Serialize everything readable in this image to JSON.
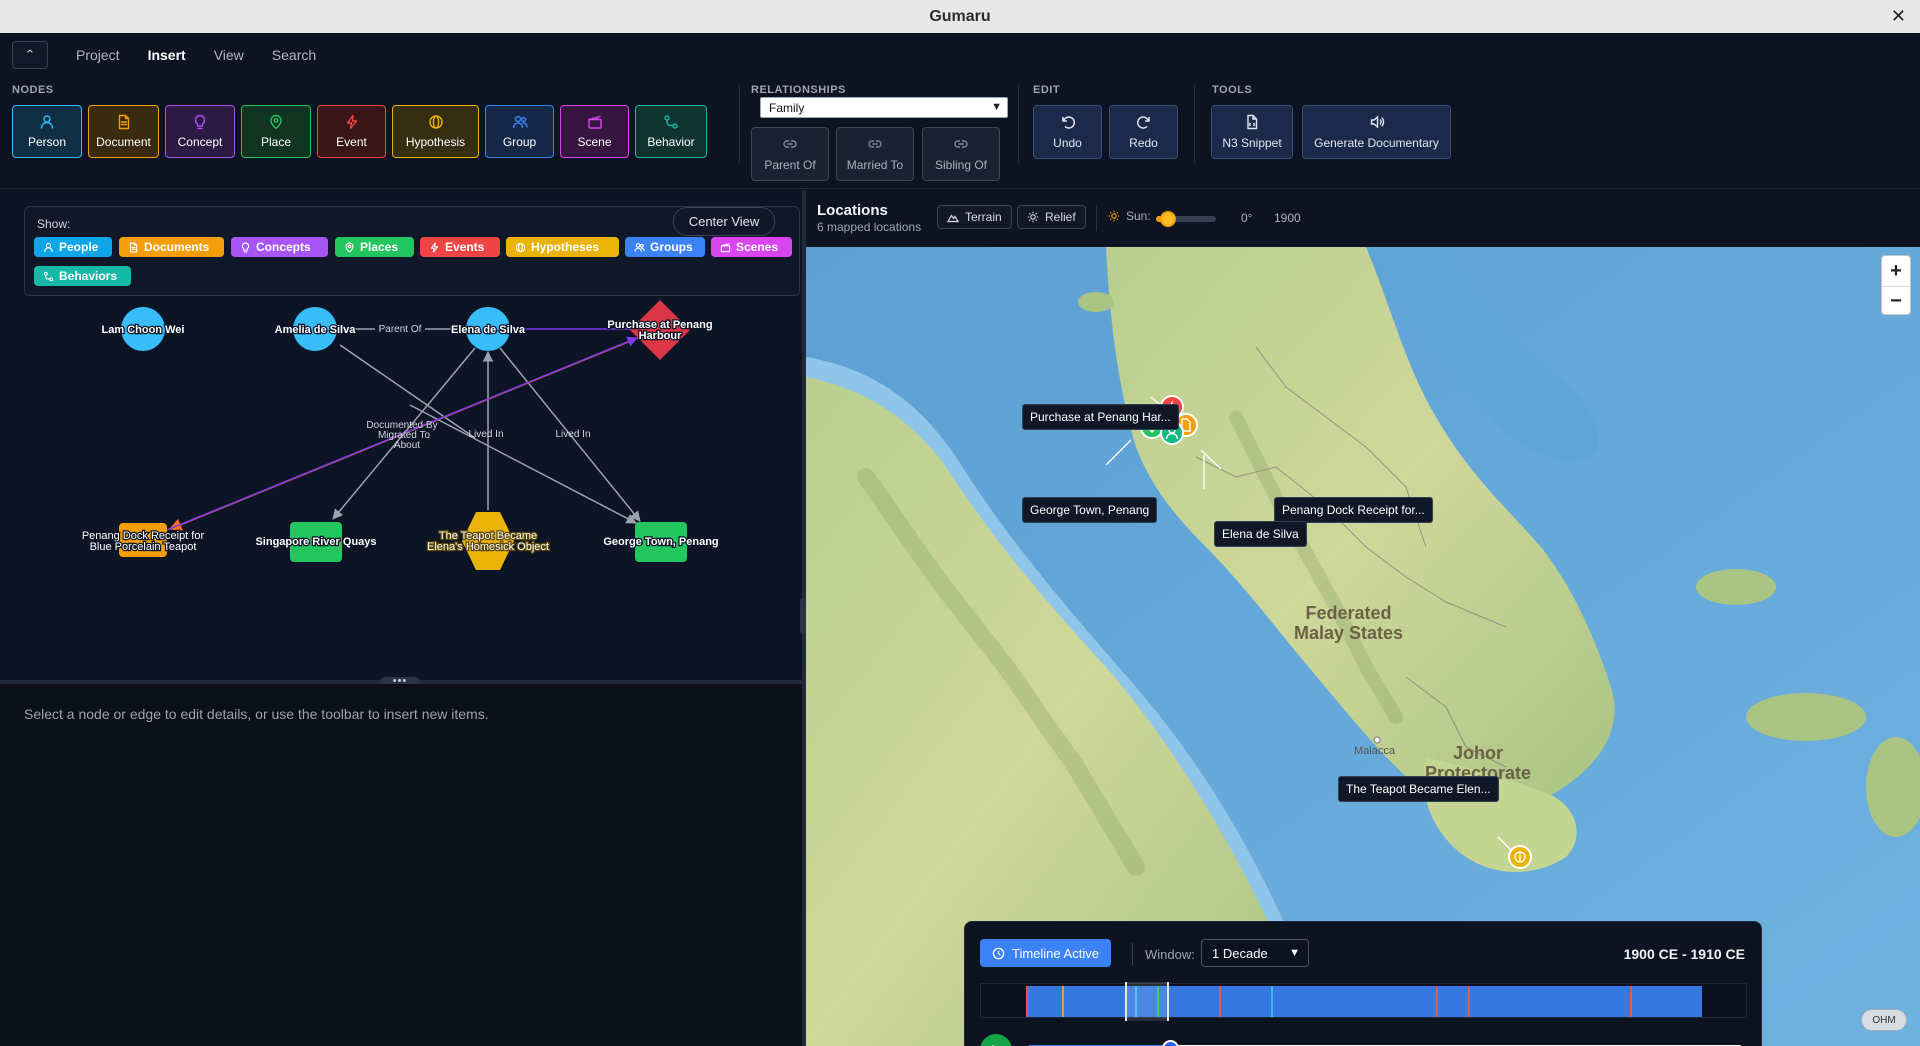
{
  "app": {
    "title": "Gumaru",
    "close_glyph": "✕"
  },
  "menu": {
    "collapse_glyph": "⌃",
    "tabs": [
      "Project",
      "Insert",
      "View",
      "Search"
    ],
    "active": "Insert"
  },
  "ribbon": {
    "nodes_label": "NODES",
    "nodes": [
      {
        "label": "Person",
        "color": "#38bdf8",
        "bg": "#0f2f44",
        "icon": "person-icon"
      },
      {
        "label": "Document",
        "color": "#f59e0b",
        "bg": "#3a2a10",
        "icon": "document-icon"
      },
      {
        "label": "Concept",
        "color": "#a855f7",
        "bg": "#2c1a42",
        "icon": "lightbulb-icon"
      },
      {
        "label": "Place",
        "color": "#22c55e",
        "bg": "#113322",
        "icon": "map-pin-icon"
      },
      {
        "label": "Event",
        "color": "#ef4444",
        "bg": "#3a1518",
        "icon": "lightning-icon"
      },
      {
        "label": "Hypothesis",
        "color": "#eab308",
        "bg": "#362e10",
        "icon": "hypothesis-icon"
      },
      {
        "label": "Group",
        "color": "#3b82f6",
        "bg": "#162848",
        "icon": "group-icon"
      },
      {
        "label": "Scene",
        "color": "#d946ef",
        "bg": "#361640",
        "icon": "scene-icon"
      },
      {
        "label": "Behavior",
        "color": "#14b8a6",
        "bg": "#0f3430",
        "icon": "behavior-icon"
      }
    ],
    "relationships_label": "RELATIONSHIPS",
    "relationship_select": "Family",
    "relationships": [
      "Parent Of",
      "Married To",
      "Sibling Of"
    ],
    "edit_label": "EDIT",
    "edit": [
      "Undo",
      "Redo"
    ],
    "tools_label": "TOOLS",
    "tools": [
      "N3 Snippet",
      "Generate Documentary"
    ]
  },
  "graph": {
    "show_label": "Show:",
    "center_view": "Center View",
    "filters": [
      {
        "label": "People",
        "color": "#0ea5e9",
        "icon": "person-icon"
      },
      {
        "label": "Documents",
        "color": "#f59e0b",
        "icon": "document-icon"
      },
      {
        "label": "Concepts",
        "color": "#a855f7",
        "icon": "lightbulb-icon"
      },
      {
        "label": "Places",
        "color": "#22c55e",
        "icon": "map-pin-icon"
      },
      {
        "label": "Events",
        "color": "#ef4444",
        "icon": "lightning-icon"
      },
      {
        "label": "Hypotheses",
        "color": "#eab308",
        "icon": "hypothesis-icon"
      },
      {
        "label": "Groups",
        "color": "#3b82f6",
        "icon": "group-icon"
      },
      {
        "label": "Scenes",
        "color": "#d946ef",
        "icon": "scene-icon"
      },
      {
        "label": "Behaviors",
        "color": "#14b8a6",
        "icon": "behavior-icon"
      }
    ],
    "nodes": {
      "lam": "Lam Choon Wei",
      "amelia": "Amelia de Silva",
      "elena": "Elena de Silva",
      "purchase": [
        "Purchase at Penang",
        "Harbour"
      ],
      "receipt": [
        "Penang Dock Receipt for",
        "Blue Porcelain Teapot"
      ],
      "singapore": "Singapore River Quays",
      "teapot": [
        "The Teapot Became",
        "Elena's Homesick Object"
      ],
      "georgetown": "George Town, Penang"
    },
    "edges": {
      "parent_of": "Parent Of",
      "documented_by": "Documented By",
      "migrated_to": "Migrated To",
      "about": "About",
      "lived_in_1": "Lived In",
      "lived_in_2": "Lived In"
    }
  },
  "details": {
    "hint": "Select a node or edge to edit details, or use the toolbar to insert new items."
  },
  "map": {
    "title": "Locations",
    "subtitle": "6 mapped locations",
    "terrain": "Terrain",
    "relief": "Relief",
    "sun_label": "Sun:",
    "sun_value": "0°",
    "sun_year": "1900",
    "sun_fraction": 0.2,
    "zoom_in": "+",
    "zoom_out": "−",
    "attribution": "OHM",
    "labels": {
      "purchase": "Purchase at Penang Har...",
      "georgetown": "George Town, Penang",
      "receipt": "Penang Dock Receipt for...",
      "elena": "Elena de Silva",
      "teapot": "The Teapot Became Elen..."
    },
    "regions": {
      "federated": [
        "Federated",
        "Malay States"
      ],
      "johor": [
        "Johor",
        "Protectorate"
      ],
      "malacca": "Malacca"
    }
  },
  "timeline": {
    "active_label": "Timeline Active",
    "window_label": "Window:",
    "window_value": "1 Decade",
    "range": "1900 CE - 1910 CE",
    "position_fraction": 0.2
  }
}
